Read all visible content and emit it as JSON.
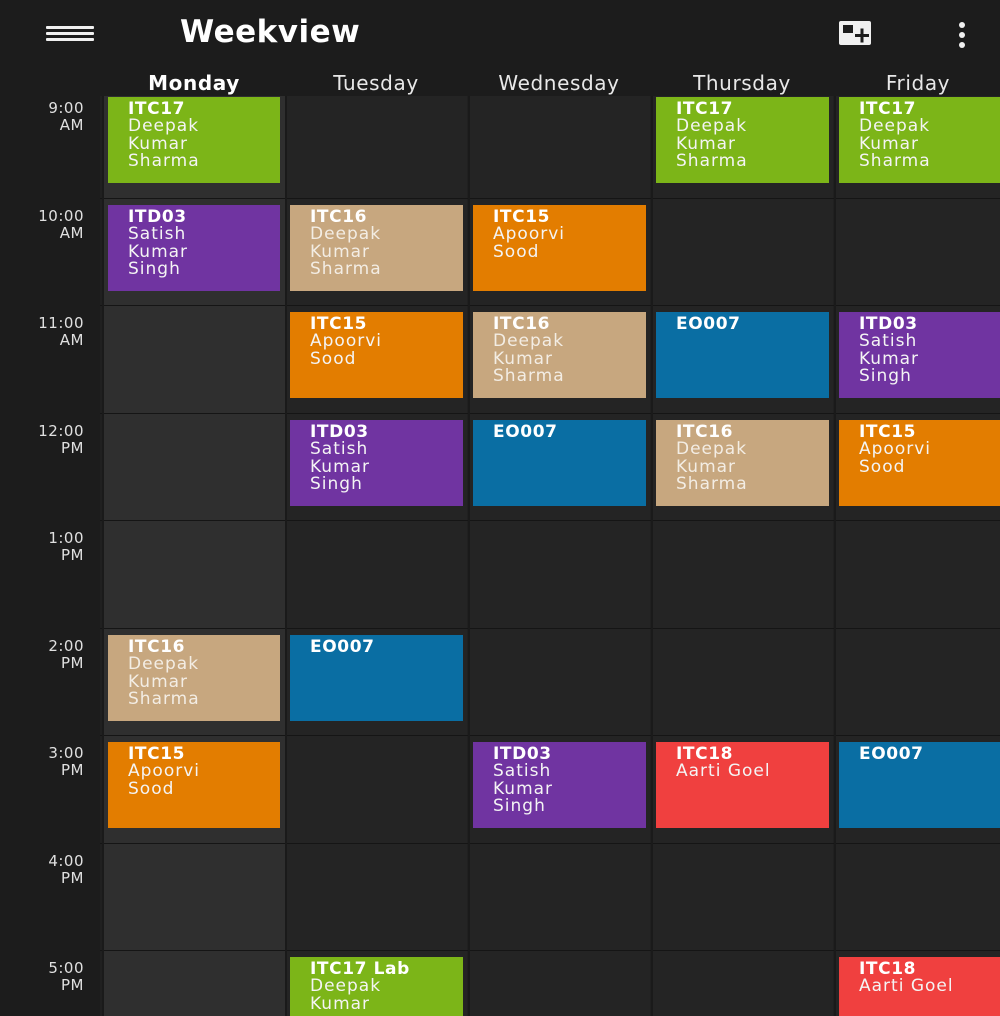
{
  "appbar": {
    "title": "Weekview",
    "icons": [
      "hamburger-menu-icon",
      "add-event-icon",
      "more-vert-icon"
    ]
  },
  "days": [
    "Monday",
    "Tuesday",
    "Wednesday",
    "Thursday",
    "Friday"
  ],
  "times": [
    {
      "h": "9:00",
      "p": "AM"
    },
    {
      "h": "10:00",
      "p": "AM"
    },
    {
      "h": "11:00",
      "p": "AM"
    },
    {
      "h": "12:00",
      "p": "PM"
    },
    {
      "h": "1:00",
      "p": "PM"
    },
    {
      "h": "2:00",
      "p": "PM"
    },
    {
      "h": "3:00",
      "p": "PM"
    },
    {
      "h": "4:00",
      "p": "PM"
    },
    {
      "h": "5:00",
      "p": "PM"
    }
  ],
  "colors": {
    "green": "#7cb518",
    "purple": "#7034a1",
    "tan": "#c7a77f",
    "orange": "#e37d00",
    "blue": "#0a6ea3",
    "red": "#f0403f",
    "today_column": "#2f2f2f",
    "background": "#202020"
  },
  "events": [
    {
      "day": 0,
      "slot": 0,
      "code": "ITC17",
      "who": "Deepak\nKumar\nSharma",
      "color": "green"
    },
    {
      "day": 3,
      "slot": 0,
      "code": "ITC17",
      "who": "Deepak\nKumar\nSharma",
      "color": "green"
    },
    {
      "day": 4,
      "slot": 0,
      "code": "ITC17",
      "who": "Deepak\nKumar\nSharma",
      "color": "green"
    },
    {
      "day": 0,
      "slot": 1,
      "code": "ITD03",
      "who": "Satish\nKumar\nSingh",
      "color": "purple"
    },
    {
      "day": 1,
      "slot": 1,
      "code": "ITC16",
      "who": "Deepak\nKumar\nSharma",
      "color": "tan"
    },
    {
      "day": 2,
      "slot": 1,
      "code": "ITC15",
      "who": "Apoorvi\nSood",
      "color": "orange"
    },
    {
      "day": 1,
      "slot": 2,
      "code": "ITC15",
      "who": "Apoorvi\nSood",
      "color": "orange"
    },
    {
      "day": 2,
      "slot": 2,
      "code": "ITC16",
      "who": "Deepak\nKumar\nSharma",
      "color": "tan"
    },
    {
      "day": 3,
      "slot": 2,
      "code": "EO007",
      "who": "",
      "color": "blue"
    },
    {
      "day": 4,
      "slot": 2,
      "code": "ITD03",
      "who": "Satish\nKumar\nSingh",
      "color": "purple"
    },
    {
      "day": 1,
      "slot": 3,
      "code": "ITD03",
      "who": "Satish\nKumar\nSingh",
      "color": "purple"
    },
    {
      "day": 2,
      "slot": 3,
      "code": "EO007",
      "who": "",
      "color": "blue"
    },
    {
      "day": 3,
      "slot": 3,
      "code": "ITC16",
      "who": "Deepak\nKumar\nSharma",
      "color": "tan"
    },
    {
      "day": 4,
      "slot": 3,
      "code": "ITC15",
      "who": "Apoorvi\nSood",
      "color": "orange"
    },
    {
      "day": 0,
      "slot": 5,
      "code": "ITC16",
      "who": "Deepak\nKumar\nSharma",
      "color": "tan"
    },
    {
      "day": 1,
      "slot": 5,
      "code": "EO007",
      "who": "",
      "color": "blue"
    },
    {
      "day": 0,
      "slot": 6,
      "code": "ITC15",
      "who": "Apoorvi\nSood",
      "color": "orange"
    },
    {
      "day": 2,
      "slot": 6,
      "code": "ITD03",
      "who": "Satish\nKumar\nSingh",
      "color": "purple"
    },
    {
      "day": 3,
      "slot": 6,
      "code": "ITC18",
      "who": "Aarti Goel",
      "color": "red"
    },
    {
      "day": 4,
      "slot": 6,
      "code": "EO007",
      "who": "",
      "color": "blue"
    },
    {
      "day": 1,
      "slot": 8,
      "code": "ITC17 Lab",
      "who": "Deepak\nKumar",
      "color": "green"
    },
    {
      "day": 4,
      "slot": 8,
      "code": "ITC18",
      "who": "Aarti Goel",
      "color": "red"
    }
  ]
}
